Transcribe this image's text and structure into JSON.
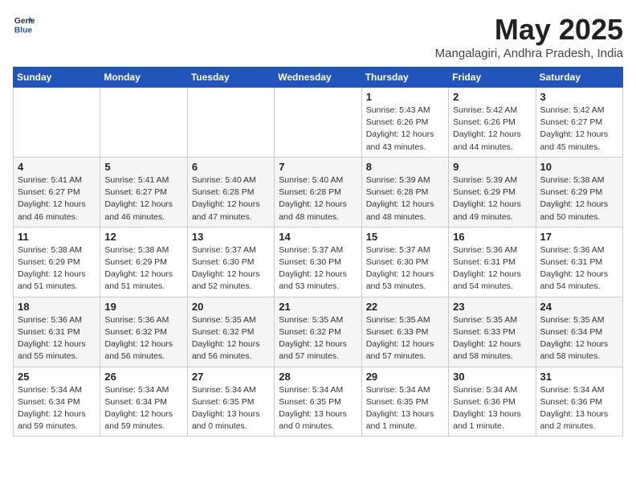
{
  "header": {
    "logo_general": "General",
    "logo_blue": "Blue",
    "month_title": "May 2025",
    "location": "Mangalagiri, Andhra Pradesh, India"
  },
  "weekdays": [
    "Sunday",
    "Monday",
    "Tuesday",
    "Wednesday",
    "Thursday",
    "Friday",
    "Saturday"
  ],
  "weeks": [
    [
      {
        "day": "",
        "detail": ""
      },
      {
        "day": "",
        "detail": ""
      },
      {
        "day": "",
        "detail": ""
      },
      {
        "day": "",
        "detail": ""
      },
      {
        "day": "1",
        "detail": "Sunrise: 5:43 AM\nSunset: 6:26 PM\nDaylight: 12 hours\nand 43 minutes."
      },
      {
        "day": "2",
        "detail": "Sunrise: 5:42 AM\nSunset: 6:26 PM\nDaylight: 12 hours\nand 44 minutes."
      },
      {
        "day": "3",
        "detail": "Sunrise: 5:42 AM\nSunset: 6:27 PM\nDaylight: 12 hours\nand 45 minutes."
      }
    ],
    [
      {
        "day": "4",
        "detail": "Sunrise: 5:41 AM\nSunset: 6:27 PM\nDaylight: 12 hours\nand 46 minutes."
      },
      {
        "day": "5",
        "detail": "Sunrise: 5:41 AM\nSunset: 6:27 PM\nDaylight: 12 hours\nand 46 minutes."
      },
      {
        "day": "6",
        "detail": "Sunrise: 5:40 AM\nSunset: 6:28 PM\nDaylight: 12 hours\nand 47 minutes."
      },
      {
        "day": "7",
        "detail": "Sunrise: 5:40 AM\nSunset: 6:28 PM\nDaylight: 12 hours\nand 48 minutes."
      },
      {
        "day": "8",
        "detail": "Sunrise: 5:39 AM\nSunset: 6:28 PM\nDaylight: 12 hours\nand 48 minutes."
      },
      {
        "day": "9",
        "detail": "Sunrise: 5:39 AM\nSunset: 6:29 PM\nDaylight: 12 hours\nand 49 minutes."
      },
      {
        "day": "10",
        "detail": "Sunrise: 5:38 AM\nSunset: 6:29 PM\nDaylight: 12 hours\nand 50 minutes."
      }
    ],
    [
      {
        "day": "11",
        "detail": "Sunrise: 5:38 AM\nSunset: 6:29 PM\nDaylight: 12 hours\nand 51 minutes."
      },
      {
        "day": "12",
        "detail": "Sunrise: 5:38 AM\nSunset: 6:29 PM\nDaylight: 12 hours\nand 51 minutes."
      },
      {
        "day": "13",
        "detail": "Sunrise: 5:37 AM\nSunset: 6:30 PM\nDaylight: 12 hours\nand 52 minutes."
      },
      {
        "day": "14",
        "detail": "Sunrise: 5:37 AM\nSunset: 6:30 PM\nDaylight: 12 hours\nand 53 minutes."
      },
      {
        "day": "15",
        "detail": "Sunrise: 5:37 AM\nSunset: 6:30 PM\nDaylight: 12 hours\nand 53 minutes."
      },
      {
        "day": "16",
        "detail": "Sunrise: 5:36 AM\nSunset: 6:31 PM\nDaylight: 12 hours\nand 54 minutes."
      },
      {
        "day": "17",
        "detail": "Sunrise: 5:36 AM\nSunset: 6:31 PM\nDaylight: 12 hours\nand 54 minutes."
      }
    ],
    [
      {
        "day": "18",
        "detail": "Sunrise: 5:36 AM\nSunset: 6:31 PM\nDaylight: 12 hours\nand 55 minutes."
      },
      {
        "day": "19",
        "detail": "Sunrise: 5:36 AM\nSunset: 6:32 PM\nDaylight: 12 hours\nand 56 minutes."
      },
      {
        "day": "20",
        "detail": "Sunrise: 5:35 AM\nSunset: 6:32 PM\nDaylight: 12 hours\nand 56 minutes."
      },
      {
        "day": "21",
        "detail": "Sunrise: 5:35 AM\nSunset: 6:32 PM\nDaylight: 12 hours\nand 57 minutes."
      },
      {
        "day": "22",
        "detail": "Sunrise: 5:35 AM\nSunset: 6:33 PM\nDaylight: 12 hours\nand 57 minutes."
      },
      {
        "day": "23",
        "detail": "Sunrise: 5:35 AM\nSunset: 6:33 PM\nDaylight: 12 hours\nand 58 minutes."
      },
      {
        "day": "24",
        "detail": "Sunrise: 5:35 AM\nSunset: 6:34 PM\nDaylight: 12 hours\nand 58 minutes."
      }
    ],
    [
      {
        "day": "25",
        "detail": "Sunrise: 5:34 AM\nSunset: 6:34 PM\nDaylight: 12 hours\nand 59 minutes."
      },
      {
        "day": "26",
        "detail": "Sunrise: 5:34 AM\nSunset: 6:34 PM\nDaylight: 12 hours\nand 59 minutes."
      },
      {
        "day": "27",
        "detail": "Sunrise: 5:34 AM\nSunset: 6:35 PM\nDaylight: 13 hours\nand 0 minutes."
      },
      {
        "day": "28",
        "detail": "Sunrise: 5:34 AM\nSunset: 6:35 PM\nDaylight: 13 hours\nand 0 minutes."
      },
      {
        "day": "29",
        "detail": "Sunrise: 5:34 AM\nSunset: 6:35 PM\nDaylight: 13 hours\nand 1 minute."
      },
      {
        "day": "30",
        "detail": "Sunrise: 5:34 AM\nSunset: 6:36 PM\nDaylight: 13 hours\nand 1 minute."
      },
      {
        "day": "31",
        "detail": "Sunrise: 5:34 AM\nSunset: 6:36 PM\nDaylight: 13 hours\nand 2 minutes."
      }
    ]
  ]
}
